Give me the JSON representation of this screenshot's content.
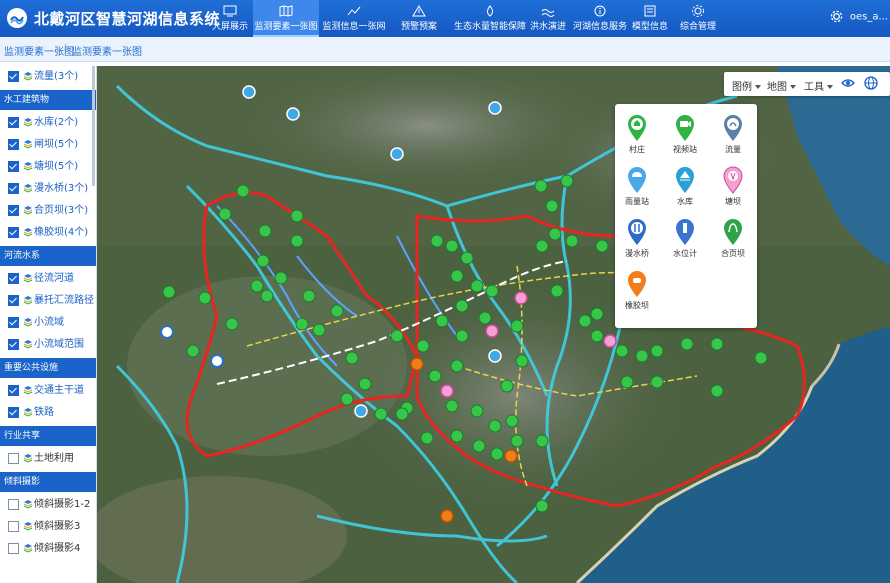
{
  "header": {
    "title": "北戴河区智慧河湖信息系统",
    "nav": [
      {
        "label": "大屏展示",
        "icon": "screen-icon"
      },
      {
        "label": "监测要素一张图",
        "icon": "map-icon"
      },
      {
        "label": "监测信息一张网",
        "icon": "chart-icon"
      },
      {
        "label": "预警预案",
        "icon": "warning-icon"
      },
      {
        "label": "生态水量智能保障",
        "icon": "water-icon"
      },
      {
        "label": "洪水演进",
        "icon": "flood-icon"
      },
      {
        "label": "河湖信息服务",
        "icon": "info-icon"
      },
      {
        "label": "模型信息",
        "icon": "model-icon"
      },
      {
        "label": "综合管理",
        "icon": "manage-icon"
      }
    ],
    "active_nav": "监测要素一张图",
    "user": "oes_a..."
  },
  "breadcrumb": [
    "监测要素一张图",
    "监测要素一张图"
  ],
  "sidebar": {
    "top_item": {
      "label": "流量(3个)",
      "checked": true
    },
    "groups": [
      {
        "title": "水工建筑物",
        "items": [
          {
            "label": "水库(2个)",
            "checked": true
          },
          {
            "label": "闸坝(5个)",
            "checked": true
          },
          {
            "label": "塘坝(5个)",
            "checked": true
          },
          {
            "label": "漫水桥(3个)",
            "checked": true
          },
          {
            "label": "合页坝(3个)",
            "checked": true
          },
          {
            "label": "橡胶坝(4个)",
            "checked": true
          }
        ]
      },
      {
        "title": "河流水系",
        "items": [
          {
            "label": "径流河道",
            "checked": true
          },
          {
            "label": "暴托汇流路径",
            "checked": true
          },
          {
            "label": "小流域",
            "checked": true
          },
          {
            "label": "小流域范围",
            "checked": true
          }
        ]
      },
      {
        "title": "重要公共设施",
        "items": [
          {
            "label": "交通主干道",
            "checked": true
          },
          {
            "label": "铁路",
            "checked": true
          }
        ]
      },
      {
        "title": "行业共享",
        "items": [
          {
            "label": "土地利用",
            "checked": false
          }
        ]
      },
      {
        "title": "倾斜摄影",
        "items": [
          {
            "label": "倾斜摄影1-2",
            "checked": false
          },
          {
            "label": "倾斜摄影3",
            "checked": false
          },
          {
            "label": "倾斜摄影4",
            "checked": false
          }
        ]
      }
    ]
  },
  "toolbar": {
    "legend_label": "图例",
    "basemap_label": "地图",
    "tools_label": "工具"
  },
  "legend": [
    {
      "label": "村庄",
      "color": "#2fb344",
      "icon": "village-icon"
    },
    {
      "label": "视频站",
      "color": "#2fb344",
      "icon": "video-icon"
    },
    {
      "label": "流量",
      "color": "#5b7fa6",
      "icon": "flow-icon"
    },
    {
      "label": "雨量站",
      "color": "#4aa8e8",
      "icon": "rain-icon"
    },
    {
      "label": "水库",
      "color": "#29a0d8",
      "icon": "reservoir-icon"
    },
    {
      "label": "塘坝",
      "color": "#e05aa8",
      "icon": "pond-dam-icon"
    },
    {
      "label": "漫水桥",
      "color": "#2d6cc8",
      "icon": "bridge-icon"
    },
    {
      "label": "水位计",
      "color": "#3a74d0",
      "icon": "water-level-icon"
    },
    {
      "label": "合页坝",
      "color": "#2fa34a",
      "icon": "hinge-dam-icon"
    },
    {
      "label": "橡胶坝",
      "color": "#f07f1a",
      "icon": "rubber-dam-icon"
    }
  ]
}
